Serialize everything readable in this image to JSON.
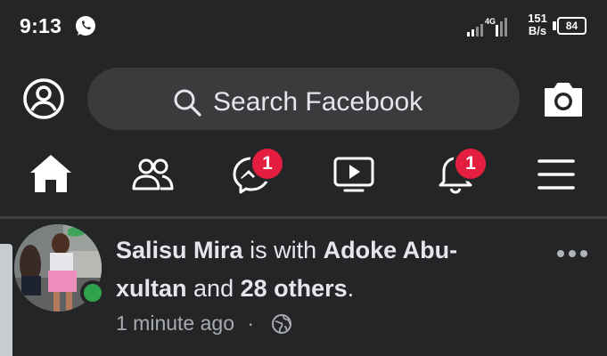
{
  "status_bar": {
    "time": "9:13",
    "network": "4G",
    "speed_value": "151",
    "speed_unit": "B/s",
    "battery": "84",
    "icons": [
      "whatsapp-icon",
      "signal-icon",
      "battery-icon"
    ]
  },
  "header": {
    "search_placeholder": "Search Facebook",
    "icons": [
      "profile-icon",
      "search-icon",
      "camera-icon"
    ]
  },
  "tabs": [
    {
      "name": "home",
      "icon": "home-icon",
      "badge": ""
    },
    {
      "name": "friends",
      "icon": "friends-icon",
      "badge": ""
    },
    {
      "name": "messenger",
      "icon": "messenger-icon",
      "badge": "1"
    },
    {
      "name": "watch",
      "icon": "video-icon",
      "badge": ""
    },
    {
      "name": "notifications",
      "icon": "bell-icon",
      "badge": "1"
    },
    {
      "name": "menu",
      "icon": "menu-icon",
      "badge": ""
    }
  ],
  "post": {
    "author": "Salisu Mira",
    "connector": "is with",
    "tagged_name": "Adoke Abu-xultan",
    "and": "and",
    "others": "28 others",
    "period": ".",
    "timestamp": "1 minute ago",
    "separator": "·",
    "privacy_icon": "globe-icon"
  },
  "colors": {
    "background": "#242526",
    "search_bg": "#3a3b3c",
    "badge": "#e41e3f",
    "online": "#31a24c",
    "text": "#e4e6eb",
    "secondary_text": "#a8abaf"
  }
}
